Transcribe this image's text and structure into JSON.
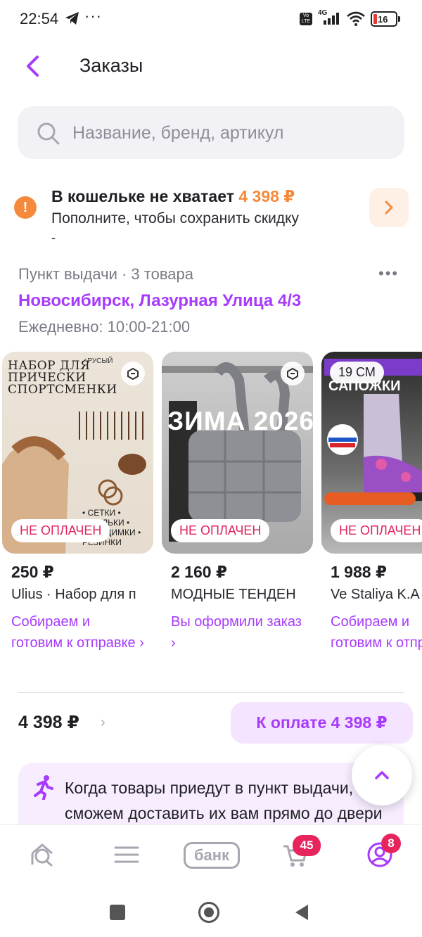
{
  "status_bar": {
    "time": "22:54",
    "dots": "···",
    "volte": "Vo LTE",
    "network": "4G",
    "battery": "16",
    "icons": [
      "telegram-icon",
      "signal-icon",
      "wifi-icon",
      "battery-icon"
    ]
  },
  "header": {
    "title": "Заказы",
    "back_icon": "chevron-left-icon"
  },
  "search": {
    "placeholder": "Название, бренд, артикул"
  },
  "wallet": {
    "title": "В кошельке не хватает ",
    "amount": "4 398 ₽",
    "subtitle": "Пополните, чтобы сохранить скидку",
    "subtitle_cut": "-"
  },
  "pickup": {
    "line": "Пункт выдачи · 3 товара",
    "more": "•••",
    "address": "Новосибирск, Лазурная Улица 4/3",
    "hours": "Ежедневно: 10:00-21:00"
  },
  "products": [
    {
      "price": "250 ₽",
      "name": "Ulius · Набор для п",
      "status": "Собираем и готовим к отправке ›",
      "badge": "НЕ ОПЛАЧЕН",
      "image_title": "НАБОР ДЛЯ ПРИЧЕСКИ СПОРТСМЕНКИ",
      "image_tag": "✓РУСЫЙ",
      "image_list": "• СЕТКИ • ШПИЛЬКИ • НЕВИДИМКИ • РЕЗИНКИ"
    },
    {
      "price": "2 160 ₽",
      "name": "МОДНЫЕ ТЕНДЕН",
      "status": "Вы оформили заказ ›",
      "badge": "НЕ ОПЛАЧЕН",
      "image_title": "ЗИМА  2026"
    },
    {
      "price": "1 988 ₽",
      "name": "Ve Staliya K.A",
      "status": "Собираем и готовим к отправке ›",
      "badge": "НЕ ОПЛАЧЕН",
      "size": "19 СМ",
      "image_title": "САПОЖКИ"
    }
  ],
  "summary": {
    "total": "4 398 ₽",
    "chevron": "›",
    "pay_button": "К оплате 4 398 ₽"
  },
  "info": {
    "text": "Когда товары приедут в пункт выдачи, сможем доставить их вам прямо до двери"
  },
  "bottom_nav": {
    "bank_label": "банк",
    "cart_badge": "45",
    "profile_badge": "8"
  },
  "colors": {
    "accent": "#a73afd",
    "orange": "#f58a3c",
    "badge_red": "#e8245d",
    "unpaid": "#e0245e"
  }
}
